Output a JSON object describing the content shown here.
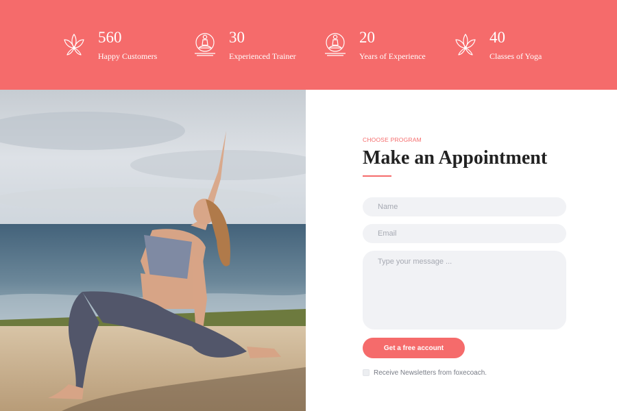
{
  "colors": {
    "accent": "#f56b6b",
    "input_bg": "#f1f2f5",
    "title": "#222222"
  },
  "stats": [
    {
      "icon": "lotus-icon",
      "number": "560",
      "label": "Happy Customers"
    },
    {
      "icon": "meditation-icon",
      "number": "30",
      "label": "Experienced Trainer"
    },
    {
      "icon": "meditation-icon",
      "number": "20",
      "label": "Years of Experience"
    },
    {
      "icon": "lotus-icon",
      "number": "40",
      "label": "Classes of Yoga"
    }
  ],
  "appointment": {
    "eyebrow": "CHOOSE PROGRAM",
    "title": "Make an Appointment",
    "name_placeholder": "Name",
    "email_placeholder": "Email",
    "message_placeholder": "Type your message ...",
    "submit_label": "Get a free account",
    "newsletter_label": "Receive Newsletters from foxecoach."
  }
}
